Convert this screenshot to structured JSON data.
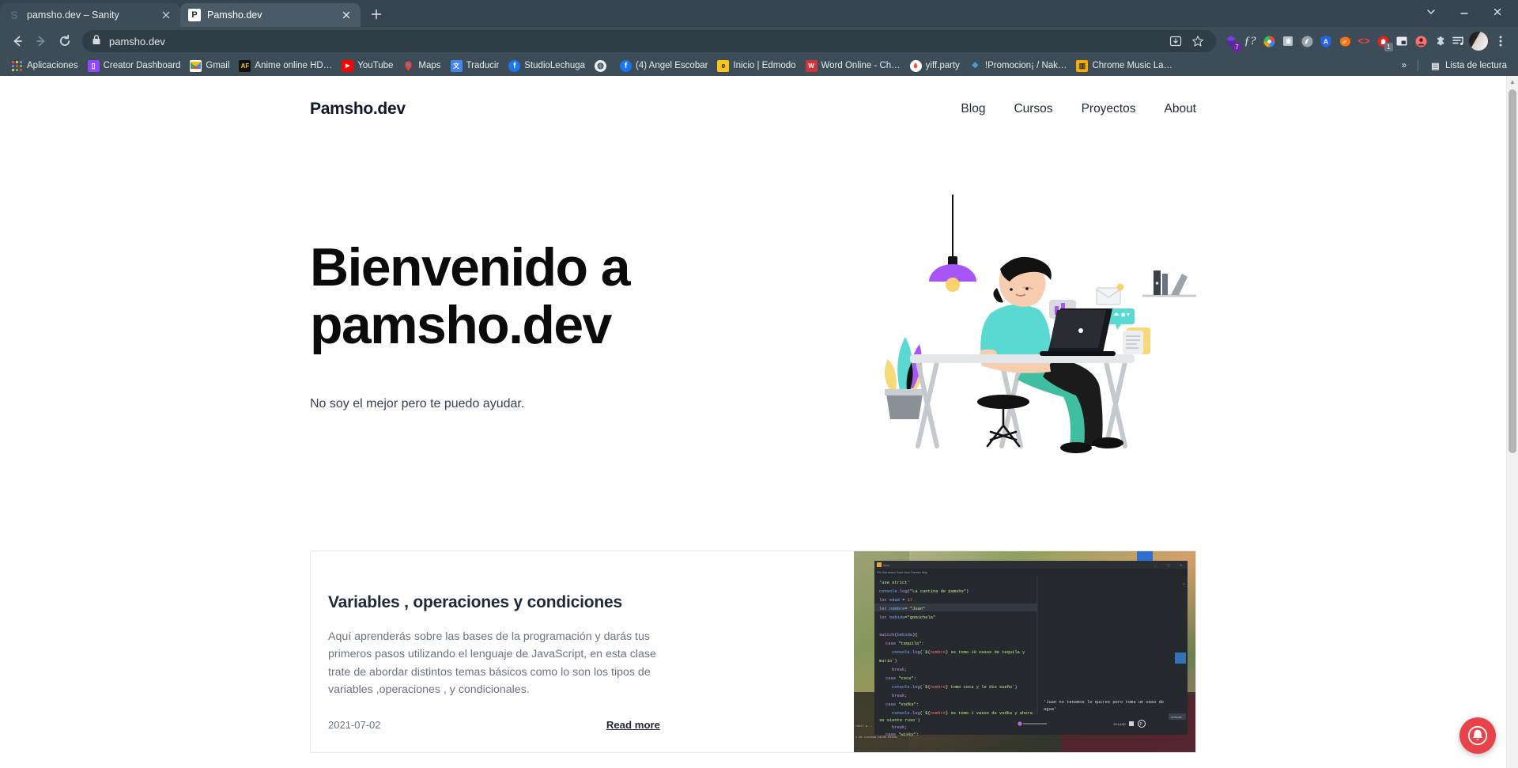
{
  "browser": {
    "tabs": [
      {
        "title": "pamsho.dev – Sanity",
        "favicon": "S",
        "active": false
      },
      {
        "title": "Pamsho.dev",
        "favicon": "P",
        "active": true
      }
    ],
    "newtab_label": "+",
    "window_controls": {
      "minimize": "—",
      "close": "✕",
      "tablist": "⌄"
    },
    "nav": {
      "back": "←",
      "forward": "→",
      "reload": "⟳"
    },
    "omnibox": {
      "url": "pamsho.dev",
      "lock_icon": "lock-icon",
      "install_icon": "install-app-icon",
      "bookmark_icon": "star-icon"
    },
    "extensions": [
      {
        "name": "sanity-extension",
        "glyph": "◆",
        "color": "#7c3aed",
        "badge": "7",
        "badge_color": "#6b21a8"
      },
      {
        "name": "font-inspector-extension",
        "glyph": "ƒ?",
        "color": "#e8eaed",
        "badge": ""
      },
      {
        "name": "color-picker-extension",
        "glyph": "◉",
        "color": "#22c55e",
        "badge": ""
      },
      {
        "name": "grayscale-extension",
        "glyph": "✋",
        "color": "#cbd5e1",
        "badge": ""
      },
      {
        "name": "privacy-badger-extension",
        "glyph": "◍",
        "color": "#9ca3af",
        "badge": ""
      },
      {
        "name": "adblock-extension",
        "glyph": "A",
        "color": "#2563eb",
        "badge": ""
      },
      {
        "name": "firefox-extension",
        "glyph": "🦊",
        "color": "#f97316",
        "badge": ""
      },
      {
        "name": "code-extension",
        "glyph": "<>",
        "color": "#ef4444",
        "badge": ""
      },
      {
        "name": "stop-extension",
        "glyph": "✋",
        "color": "#dc2626",
        "badge": "1",
        "badge_color": "#6b7280"
      },
      {
        "name": "picture-in-picture-extension",
        "glyph": "▣",
        "color": "#e8eaed",
        "badge": ""
      },
      {
        "name": "user-extension",
        "glyph": "☻",
        "color": "#f87171",
        "badge": ""
      },
      {
        "name": "puzzle-extensions-icon",
        "glyph": "🧩",
        "color": "#cbd5e1",
        "badge": ""
      },
      {
        "name": "reading-list-icon",
        "glyph": "≡♪",
        "color": "#e8eaed",
        "badge": ""
      }
    ],
    "profile_avatar": "avatar",
    "menu_icon": "⋮",
    "bookmarks": [
      {
        "label": "Aplicaciones",
        "icon": "apps-grid-icon",
        "color": "#e8eaed",
        "glyph": "⠿"
      },
      {
        "label": "Creator Dashboard",
        "icon": "twitch-icon",
        "color": "#9146ff",
        "glyph": "▯"
      },
      {
        "label": "Gmail",
        "icon": "gmail-icon",
        "color": "#ffffff",
        "glyph": "M"
      },
      {
        "label": "Anime online HD…",
        "icon": "animeflv-icon",
        "color": "#000000",
        "glyph": "AF"
      },
      {
        "label": "YouTube",
        "icon": "youtube-icon",
        "color": "#ff0000",
        "glyph": "▶"
      },
      {
        "label": "Maps",
        "icon": "google-maps-icon",
        "color": "#4285f4",
        "glyph": "◉"
      },
      {
        "label": "Traducir",
        "icon": "google-translate-icon",
        "color": "#4285f4",
        "glyph": "G"
      },
      {
        "label": "StudioLechuga",
        "icon": "facebook-icon",
        "color": "#1877f2",
        "glyph": "f"
      },
      {
        "label": "",
        "icon": "globe-icon",
        "color": "#e8eaed",
        "glyph": "◍"
      },
      {
        "label": "(4) Angel Escobar",
        "icon": "facebook-icon",
        "color": "#1877f2",
        "glyph": "f"
      },
      {
        "label": "Inicio | Edmodo",
        "icon": "edmodo-icon",
        "color": "#f5c518",
        "glyph": "e"
      },
      {
        "label": "Word Online - Ch…",
        "icon": "word-icon",
        "color": "#d13438",
        "glyph": "W"
      },
      {
        "label": "yiff.party",
        "icon": "yiff-icon",
        "color": "#ffffff",
        "glyph": "▲"
      },
      {
        "label": "!Promocion¡ / Nak…",
        "icon": "nakama-icon",
        "color": "#4aa3df",
        "glyph": "❖"
      },
      {
        "label": "Chrome Music La…",
        "icon": "chrome-music-lab-icon",
        "color": "#f9ab00",
        "glyph": "▥"
      }
    ],
    "overflow_label": "»",
    "reading_list": {
      "label": "Lista de lectura",
      "icon": "reading-list-icon",
      "glyph": "▤"
    }
  },
  "site": {
    "brand": "Pamsho.dev",
    "nav": [
      {
        "label": "Blog"
      },
      {
        "label": "Cursos"
      },
      {
        "label": "Proyectos"
      },
      {
        "label": "About"
      }
    ],
    "hero": {
      "title_line1": "Bienvenido a",
      "title_line2": "pamsho.dev",
      "subtitle": "No soy el mejor pero te puedo ayudar.",
      "illustration": "person-working-at-desk-illustration"
    },
    "posts": [
      {
        "title": "Variables , operaciones y condiciones",
        "excerpt": "Aquí aprenderás sobre las bases de la programación y darás tus primeros pasos utilizando el lenguaje de JavaScript, en esta clase trate de abordar distintos temas básicos como lo son los tipos de variables ,operaciones , y condicionales.",
        "date": "2021-07-02",
        "read_more": "Read more",
        "thumbnail": "code-editor-screenshot",
        "thumbnail_code": [
          "'use strict'",
          "console.log(\"La cantina de pamsho\")",
          "let edad = 17",
          "let nombre= \"Juan\"",
          "let bebida=\"gomichela\"",
          "",
          "switch(bebida){",
          "  case \"tequila\":",
          "    console.log(`${nombre} se tomo 10 vasos de tequila y",
          "murio`)",
          "    break;",
          "  case \"coca\":",
          "    console.log(`${nombre} tomo coca y  le dio sueño`)",
          "    break;",
          "  case \"vodka\":",
          "    console.log(`${nombre} se tomo 1 vasos de vodka y ahora",
          "se siente ruso`)",
          "    break;",
          "  case \"wisky\":"
        ],
        "thumbnail_console": "'Juan no tenemos lo quires pero toma un vaso de agua'"
      }
    ]
  },
  "overlay": {
    "notification_bell": "notification-bell-icon"
  },
  "colors": {
    "chrome_tabstrip": "#35444e",
    "chrome_toolbar": "#3d4d58",
    "omnibox": "#2f3d47",
    "page_bg": "#ffffff",
    "heading": "#0b0b0b",
    "muted_text": "#6b7280",
    "card_border": "#e5e7eb",
    "bell_red": "#e8434a"
  }
}
